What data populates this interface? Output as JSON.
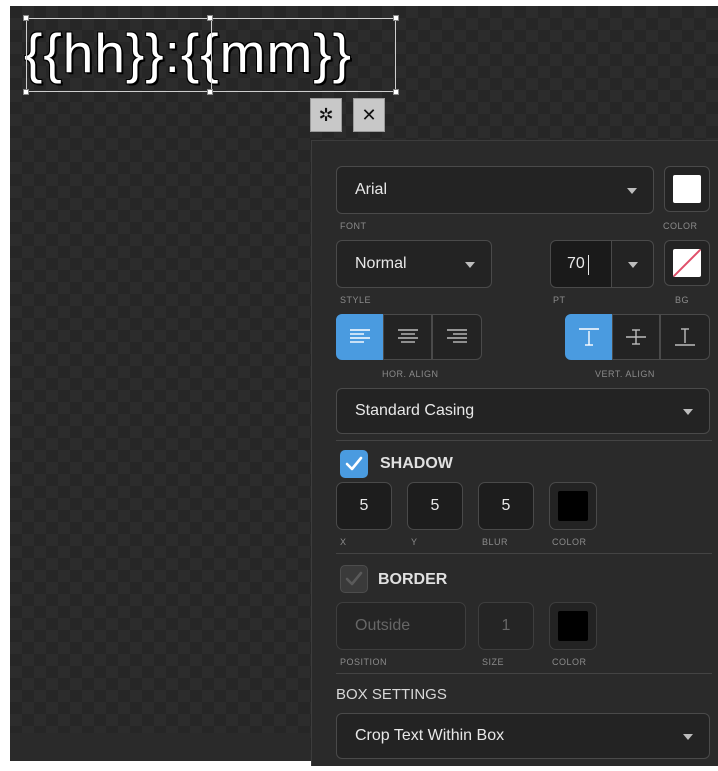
{
  "canvas": {
    "text_content": "{{hh}}:{{mm}}",
    "settings_icon": "gear-icon",
    "close_icon": "close-icon"
  },
  "panel": {
    "font": {
      "value": "Arial",
      "label": "FONT"
    },
    "color": {
      "label": "COLOR",
      "value": "#ffffff"
    },
    "style": {
      "value": "Normal",
      "label": "STYLE"
    },
    "pt": {
      "value": "70",
      "label": "PT"
    },
    "bg": {
      "label": "BG",
      "value": "none"
    },
    "hor_align": {
      "label": "HOR. ALIGN",
      "options": [
        "left",
        "center",
        "right"
      ],
      "selected": "left"
    },
    "vert_align": {
      "label": "VERT. ALIGN",
      "options": [
        "top",
        "middle",
        "bottom"
      ],
      "selected": "top"
    },
    "casing": {
      "value": "Standard Casing"
    },
    "shadow": {
      "title": "SHADOW",
      "checked": true,
      "x": "5",
      "y": "5",
      "blur": "5",
      "x_label": "X",
      "y_label": "Y",
      "blur_label": "BLUR",
      "color_label": "COLOR",
      "color": "#000000"
    },
    "border": {
      "title": "BORDER",
      "checked": false,
      "position": "Outside",
      "size": "1",
      "position_label": "POSITION",
      "size_label": "SIZE",
      "color_label": "COLOR",
      "color": "#000000"
    },
    "box_settings": {
      "title": "BOX SETTINGS",
      "value": "Crop Text Within Box"
    }
  },
  "colors": {
    "accent": "#4a9be0",
    "panel_bg": "#2a2a2a"
  }
}
